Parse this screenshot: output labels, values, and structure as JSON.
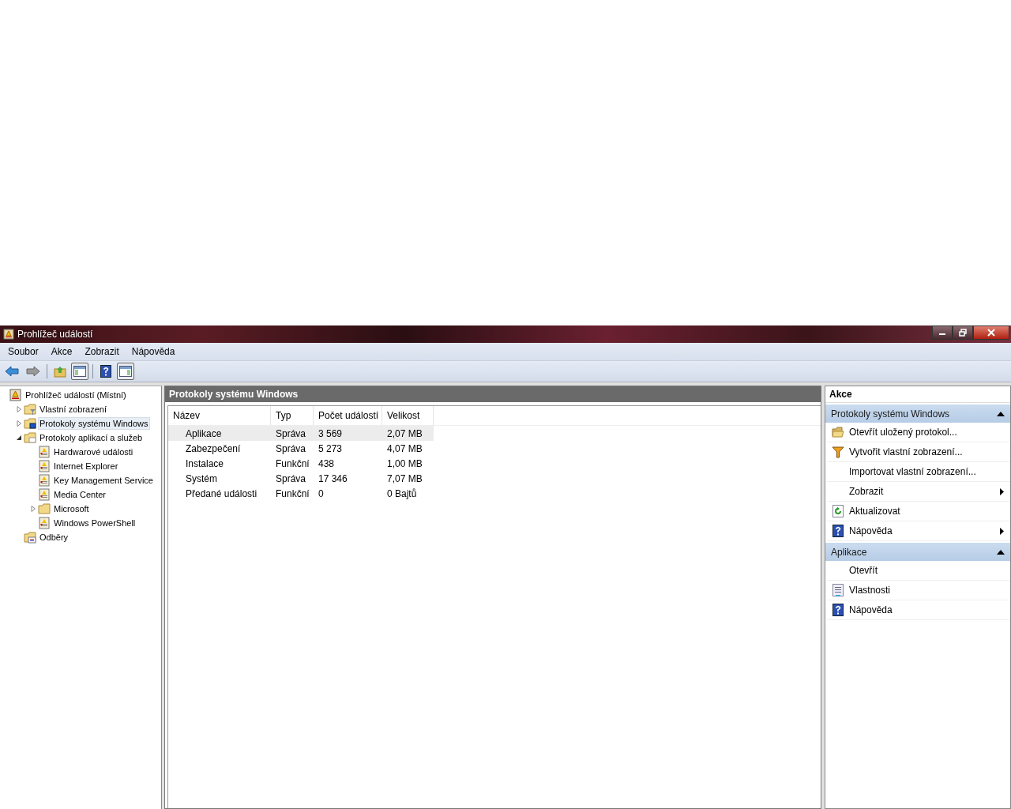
{
  "window": {
    "title": "Prohlížeč událostí"
  },
  "menu": [
    "Soubor",
    "Akce",
    "Zobrazit",
    "Nápověda"
  ],
  "tree": [
    {
      "label": "Prohlížeč událostí (Místní)",
      "kind": "root",
      "selected": false,
      "children": [
        {
          "label": "Vlastní zobrazení",
          "kind": "filter-folder",
          "expanded": false,
          "selected": false
        },
        {
          "label": "Protokoly systému Windows",
          "kind": "windows-folder",
          "expanded": false,
          "selected": true
        },
        {
          "label": "Protokoly aplikací a služeb",
          "kind": "folder-open",
          "expanded": true,
          "selected": false,
          "children": [
            {
              "label": "Hardwarové události",
              "kind": "log",
              "selected": false
            },
            {
              "label": "Internet Explorer",
              "kind": "log",
              "selected": false
            },
            {
              "label": "Key Management Service",
              "kind": "log",
              "selected": false
            },
            {
              "label": "Media Center",
              "kind": "log",
              "selected": false
            },
            {
              "label": "Microsoft",
              "kind": "folder",
              "expanded": false,
              "selected": false
            },
            {
              "label": "Windows PowerShell",
              "kind": "log",
              "selected": false
            }
          ]
        },
        {
          "label": "Odběry",
          "kind": "subscriptions",
          "selected": false
        }
      ]
    }
  ],
  "panel": {
    "title": "Protokoly systému Windows",
    "columns": [
      "Název",
      "Typ",
      "Počet událostí",
      "Velikost"
    ],
    "rows": [
      {
        "cells": [
          "Aplikace",
          "Správa",
          "3 569",
          "2,07 MB"
        ],
        "selected": true
      },
      {
        "cells": [
          "Zabezpečení",
          "Správa",
          "5 273",
          "4,07 MB"
        ],
        "selected": false
      },
      {
        "cells": [
          "Instalace",
          "Funkční",
          "438",
          "1,00 MB"
        ],
        "selected": false
      },
      {
        "cells": [
          "Systém",
          "Správa",
          "17 346",
          "7,07 MB"
        ],
        "selected": false
      },
      {
        "cells": [
          "Předané události",
          "Funkční",
          "0",
          "0 Bajtů"
        ],
        "selected": false
      }
    ]
  },
  "actions": {
    "title": "Akce",
    "sections": [
      {
        "title": "Protokoly systému Windows",
        "expanded": true,
        "items": [
          {
            "label": "Otevřít uložený protokol...",
            "kind": "open-folder",
            "submenu": false
          },
          {
            "label": "Vytvořit vlastní zobrazení...",
            "kind": "filter",
            "submenu": false
          },
          {
            "label": "Importovat vlastní zobrazení...",
            "kind": "plain",
            "submenu": false
          },
          {
            "label": "Zobrazit",
            "kind": "plain",
            "submenu": true
          },
          {
            "label": "Aktualizovat",
            "kind": "refresh",
            "submenu": false
          },
          {
            "label": "Nápověda",
            "kind": "help",
            "submenu": true
          }
        ]
      },
      {
        "title": "Aplikace",
        "expanded": true,
        "items": [
          {
            "label": "Otevřít",
            "kind": "plain",
            "submenu": false
          },
          {
            "label": "Vlastnosti",
            "kind": "properties",
            "submenu": false
          },
          {
            "label": "Nápověda",
            "kind": "help",
            "submenu": false
          }
        ]
      }
    ]
  }
}
